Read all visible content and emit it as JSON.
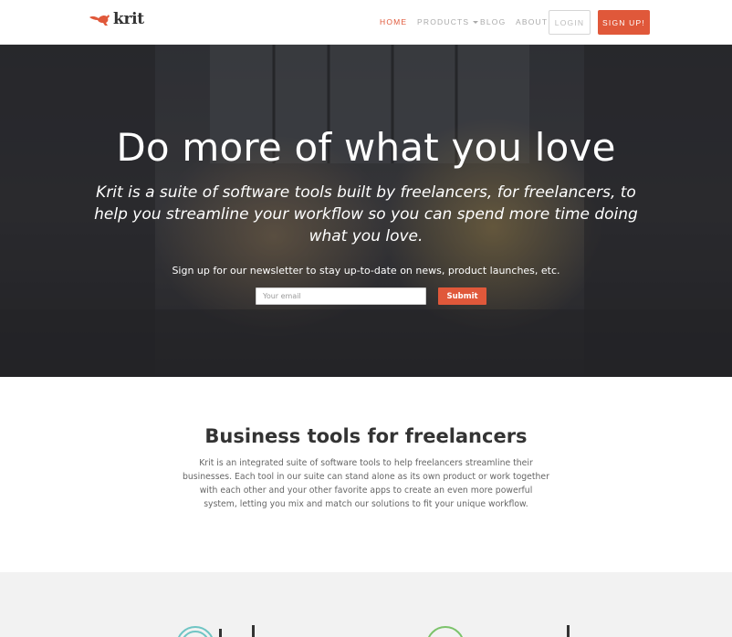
{
  "brand": {
    "name": "krit",
    "accent": "#e0583a"
  },
  "nav": {
    "home": "HOME",
    "products": "PRODUCTS",
    "blog": "BLOG",
    "about": "ABOUT",
    "login": "LOGIN",
    "signup": "SIGN UP!"
  },
  "hero": {
    "title": "Do more of what you love",
    "subtitle": "Krit is a suite of software tools built by freelancers, for freelancers, to help you streamline your workflow so you can spend more time doing what you love.",
    "newsletter_text": "Sign up for our newsletter to stay up-to-date on news, product launches, etc.",
    "email_placeholder": "Your email",
    "submit_label": "Submit"
  },
  "intro": {
    "title": "Business tools for freelancers",
    "body": "Krit is an integrated suite of software tools to help freelancers streamline their businesses. Each tool in our suite can stand alone as its own product or work together with each other and your other favorite apps to create an even more powerful system, letting you mix and match our solutions to fit your unique workflow."
  }
}
